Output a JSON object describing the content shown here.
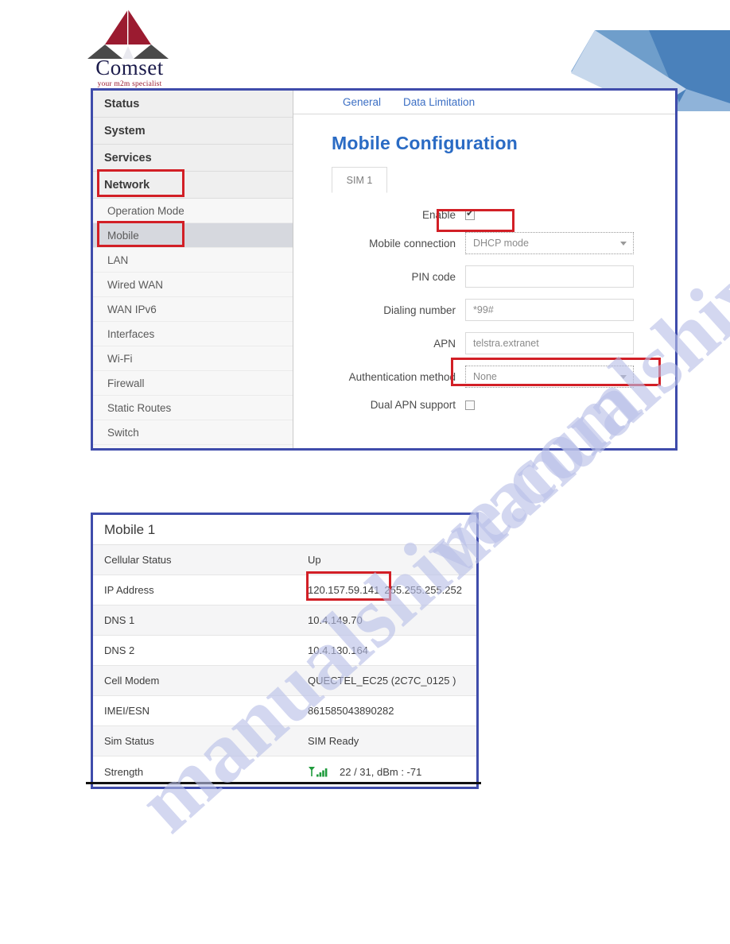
{
  "brand": {
    "name": "Comset",
    "tagline": "your m2m specialist",
    "logo_colors": {
      "crimson": "#9b1b30",
      "slate": "#4a4a4a",
      "wordmark": "#1b1b4b"
    }
  },
  "watermark": {
    "text": "manualshive.com",
    "color": "#b9c0e8"
  },
  "router_ui": {
    "sidebar": {
      "top_items": [
        {
          "label": "Status"
        },
        {
          "label": "System"
        },
        {
          "label": "Services"
        },
        {
          "label": "Network",
          "highlighted": true
        }
      ],
      "sub_items": [
        {
          "label": "Operation Mode"
        },
        {
          "label": "Mobile",
          "active": true,
          "highlighted": true
        },
        {
          "label": "LAN"
        },
        {
          "label": "Wired WAN"
        },
        {
          "label": "WAN IPv6"
        },
        {
          "label": "Interfaces"
        },
        {
          "label": "Wi-Fi"
        },
        {
          "label": "Firewall"
        },
        {
          "label": "Static Routes"
        },
        {
          "label": "Switch"
        }
      ]
    },
    "tabs": [
      {
        "label": "General"
      },
      {
        "label": "Data Limitation"
      }
    ],
    "page_title": "Mobile Configuration",
    "title_color": "#2a6bc4",
    "sim_tab": "SIM 1",
    "form": {
      "enable": {
        "label": "Enable",
        "checked": true,
        "highlighted": true
      },
      "mobile_connection": {
        "label": "Mobile connection",
        "value": "DHCP mode",
        "type": "select"
      },
      "pin_code": {
        "label": "PIN code",
        "value": ""
      },
      "dialing_number": {
        "label": "Dialing number",
        "value": "*99#"
      },
      "apn": {
        "label": "APN",
        "value": "telstra.extranet",
        "highlighted": true
      },
      "authentication_method": {
        "label": "Authentication method",
        "value": "None",
        "type": "select"
      },
      "dual_apn_support": {
        "label": "Dual APN support",
        "checked": false
      }
    }
  },
  "status_table": {
    "caption": "Mobile 1",
    "rows": [
      {
        "key": "Cellular Status",
        "value": "Up"
      },
      {
        "key": "IP Address",
        "value": "120.157.59.141",
        "value2": "255.255.255.252",
        "highlighted": true
      },
      {
        "key": "DNS 1",
        "value": "10.4.149.70"
      },
      {
        "key": "DNS 2",
        "value": "10.4.130.164"
      },
      {
        "key": "Cell Modem",
        "value": "QUECTEL_EC25 (2C7C_0125 )"
      },
      {
        "key": "IMEI/ESN",
        "value": "861585043890282"
      },
      {
        "key": "Sim Status",
        "value": "SIM Ready"
      },
      {
        "key": "Strength",
        "value": "22 / 31, dBm : -71",
        "icon": "signal-bars-icon",
        "icon_color": "#1f9b3c"
      }
    ]
  },
  "annotation_color": "#d21f26",
  "panel_border_color": "#3f4cab"
}
